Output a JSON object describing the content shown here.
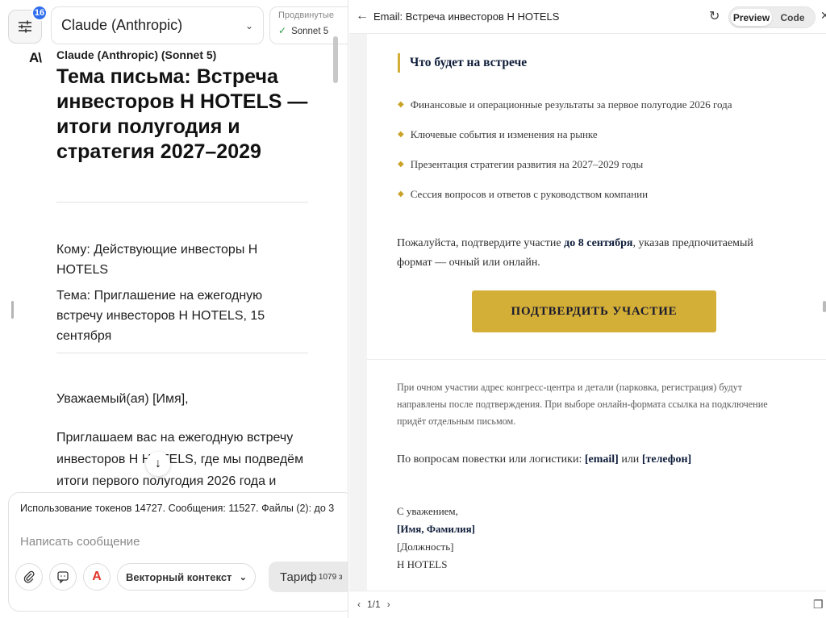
{
  "left": {
    "badge_count": "16",
    "model_label": "Claude (Anthropic)",
    "advanced_title": "Продвинутые",
    "advanced_value": "Sonnet 5",
    "message": {
      "sender": "Claude (Anthropic) (Sonnet 5)",
      "subject_title": "Тема письма: Встреча инвесторов H HOTELS — итоги полугодия и стратегия 2027–2029",
      "to_line": "Кому: Действующие инвесторы H HOTELS",
      "subject_line": "Тема: Приглашение на ежегодную встречу инвесторов H HOTELS, 15 сентября",
      "greeting": "Уважаемый(ая) [Имя],",
      "body": "Приглашаем вас на ежегодную встречу инвесторов H HOTELS, где мы подведём итоги первого полугодия 2026 года и"
    },
    "composer": {
      "usage": "Использование токенов 14727. Сообщения: 11527. Файлы (2): до 3",
      "placeholder": "Написать сообщение",
      "vector_context_label": "Векторный контекст",
      "tariff_label": "Тариф",
      "tariff_sup": "1079 з"
    }
  },
  "right": {
    "title": "Email: Встреча инвесторов H HOTELS",
    "tab_preview": "Preview",
    "tab_code": "Code",
    "email": {
      "section_heading": "Что будет на встрече",
      "bullets": [
        "Финансовые и операционные результаты за первое полугодие 2026 года",
        "Ключевые события и изменения на рынке",
        "Презентация стратегии развития на 2027–2029 годы",
        "Сессия вопросов и ответов с руководством компании"
      ],
      "confirm_pre": "Пожалуйста, подтвердите участие ",
      "confirm_bold": "до 8 сентября",
      "confirm_post": ", указав предпочитаемый формат — очный или онлайн.",
      "cta_label": "ПОДТВЕРДИТЬ УЧАСТИЕ",
      "note": "При очном участии адрес конгресс-центра и детали (парковка, регистрация) будут направлены после подтверждения. При выборе онлайн-формата ссылка на подключение придёт отдельным письмом.",
      "contact_pre": "По вопросам повестки или логистики: ",
      "contact_email": "[email]",
      "contact_or": " или ",
      "contact_phone": "[телефон]",
      "sign_regards": "С уважением,",
      "sign_name": "[Имя, Фамилия]",
      "sign_position": "[Должность]",
      "sign_company": "H HOTELS"
    },
    "pager": "1/1"
  },
  "icons": [
    "sliders-icon",
    "chevron-down-icon",
    "check-icon",
    "anthropic-logo-icon",
    "arrow-down-icon",
    "paperclip-icon",
    "message-icon",
    "a-logo-icon",
    "back-arrow-icon",
    "refresh-icon",
    "close-icon",
    "copy-icon",
    "chevron-left-icon",
    "chevron-right-icon"
  ],
  "colors": {
    "accent_gold": "#d4af37",
    "navy": "#0f1d3a",
    "badge_blue": "#2f6fed"
  }
}
